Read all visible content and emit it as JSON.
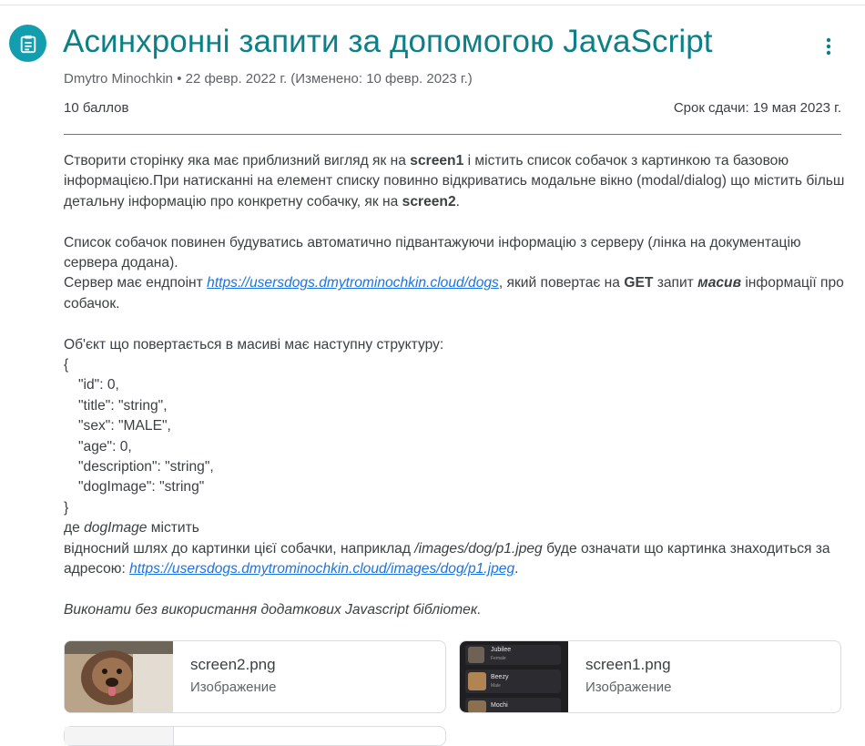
{
  "assignment": {
    "title": "Асинхронні запити за допомогою JavaScript",
    "meta": "Dmytro Minochkin • 22 февр. 2022 г. (Изменено: 10 февр. 2023 г.)",
    "points": "10 баллов",
    "due": "Срок сдачи: 19 мая 2023 г."
  },
  "colors": {
    "accent": "#129eaf",
    "title": "#0d7f86",
    "link": "#1a73e8"
  },
  "icons": {
    "assignment": "assignment-clipboard-icon",
    "more": "more-vert-icon"
  },
  "description": {
    "p1_a": "Створити сторінку яка має приблизний вигляд як на ",
    "p1_b": "screen1",
    "p1_c": " і містить список собачок з картинкою та базовою інформацією.При натисканні на елемент списку повинно відкриватись модальне вікно (modal/dialog) що містить більш детальну інформацію про конкретну собачку, як на ",
    "p1_d": "screen2",
    "p1_e": ".",
    "p2": "Список собачок повинен будуватись автоматично підвантажуючи інформацію з серверу (лінка на документацію сервера додана).",
    "p3_a": "Сервер має ендпоінт ",
    "p3_link": "https://usersdogs.dmytrominochkin.cloud/dogs",
    "p3_b": ", який повертає на ",
    "p3_get": "GET",
    "p3_c": " запит ",
    "p3_arr": "масив",
    "p3_d": " інформації про собачок.",
    "p4": "Об'єкт що повертається в масиві має наступну структуру:",
    "code": [
      "{",
      "\"id\": 0,",
      "\"title\": \"string\",",
      "\"sex\": \"MALE\",",
      "\"age\": 0,",
      "\"description\": \"string\",",
      "\"dogImage\": \"string\"",
      "}"
    ],
    "p5_a": "де ",
    "p5_em": "dogImage",
    "p5_b": " містить",
    "p6_a": "відносний шлях до картинки цієї собачки, наприклад ",
    "p6_em": "/images/dog/p1.jpeg",
    "p6_b": " буде означати що картинка знаходиться за адресою: ",
    "p6_link": "https://usersdogs.dmytrominochkin.cloud/images/dog/p1.jpeg",
    "p6_c": ".",
    "p7": "Виконати без використання додаткових Javascript бібліотек."
  },
  "attachments": [
    {
      "name": "screen2.png",
      "type": "Изображение"
    },
    {
      "name": "screen1.png",
      "type": "Изображение",
      "thumb_items": [
        {
          "name": "Jubilee",
          "sex": "Female"
        },
        {
          "name": "Beezy",
          "sex": "Male"
        },
        {
          "name": "Mochi",
          "sex": ""
        }
      ]
    }
  ]
}
